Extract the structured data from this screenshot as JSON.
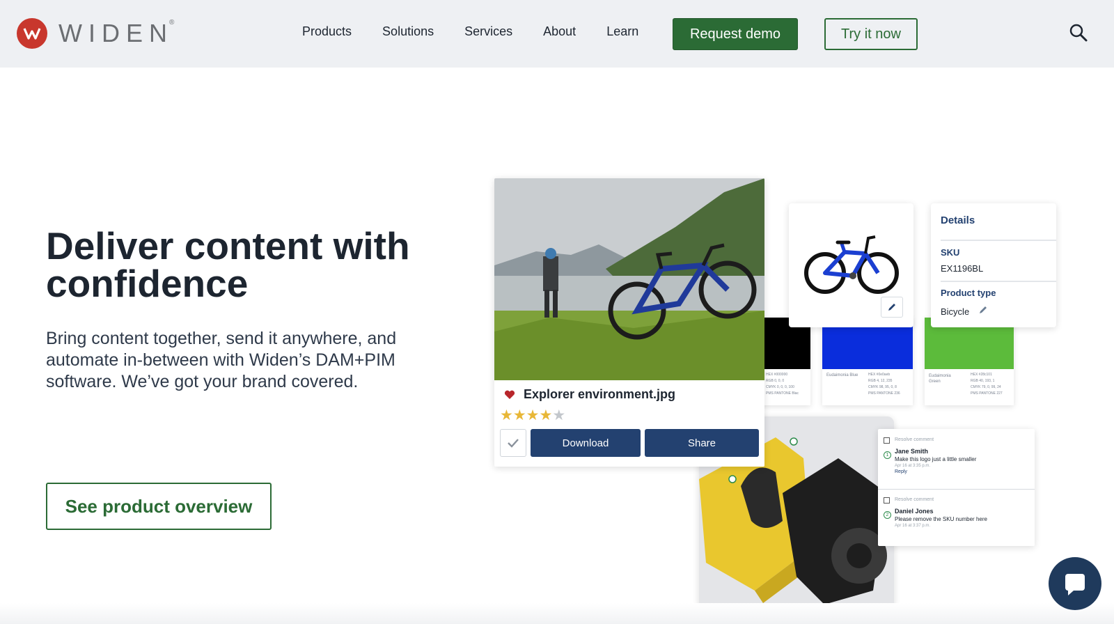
{
  "nav": {
    "logo_text": "WIDEN",
    "logo_reg": "®",
    "links": [
      "Products",
      "Solutions",
      "Services",
      "About",
      "Learn"
    ],
    "request_demo": "Request demo",
    "try_now": "Try it now"
  },
  "hero": {
    "title": "Deliver content with confidence",
    "subtitle": "Bring content together, send it anywhere, and automate in-between with Widen’s DAM+PIM software. We’ve got your brand covered.",
    "cta": "See product overview"
  },
  "asset_card": {
    "file_name": "Explorer environment.jpg",
    "rating": 4,
    "max_rating": 5,
    "download": "Download",
    "share": "Share"
  },
  "swatches": [
    {
      "name": "",
      "color": "#000000",
      "lines": [
        "HEX  #000000",
        "RGB  0, 0, 0",
        "CMYK 0, 0, 0, 100",
        "PMS  PANTONE Blac"
      ]
    },
    {
      "name": "Eudaimonia Blue",
      "color": "#0a2ddc",
      "lines": [
        "HEX  #0e0aeb",
        "RGB  4, 12, 235",
        "CMYK 98, 95, 0, 8",
        "PMS  PANTONE 236"
      ]
    },
    {
      "name": "Eudaimonia Green",
      "color": "#5cbb3b",
      "lines": [
        "HEX  #28c101",
        "RGB  40, 193, 1",
        "CMYK 79, 0, 99, 24",
        "PMS  PANTONE 227"
      ]
    }
  ],
  "details": {
    "title": "Details",
    "sku_label": "SKU",
    "sku_value": "EX1196BL",
    "type_label": "Product type",
    "type_value": "Bicycle"
  },
  "comments": [
    {
      "resolve": "Resolve comment",
      "pin": "1",
      "name": "Jane Smith",
      "text": "Make this logo just a little smaller",
      "date": "Apr 16 at 3:35 p.m.",
      "reply": "Reply"
    },
    {
      "resolve": "Resolve comment",
      "pin": "2",
      "name": "Daniel Jones",
      "text": "Please remove the SKU number here",
      "date": "Apr 16 at 3:37 p.m.",
      "reply": ""
    }
  ],
  "colors": {
    "brand_green": "#2b6b35",
    "navy": "#234170",
    "logo_red": "#c8372d",
    "nav_bg": "#eef0f3"
  },
  "icons": [
    "widen-logo-icon",
    "search-icon",
    "heart-icon",
    "star-icon",
    "check-icon",
    "pencil-icon",
    "chat-icon"
  ]
}
